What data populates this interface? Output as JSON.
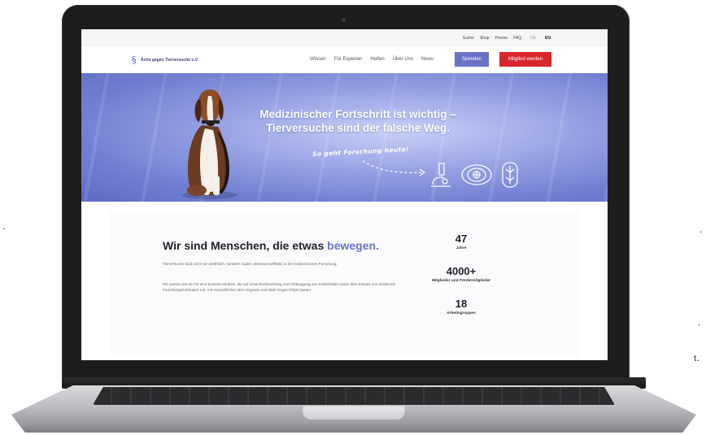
{
  "site": {
    "utility_links": [
      "Suche",
      "Shop",
      "Presse",
      "FAQ"
    ],
    "languages": [
      "DE",
      "EN"
    ],
    "active_language": "EN",
    "logo_text": "Ärzte gegen Tierversuche e.V.",
    "nav": [
      "Wissen",
      "Für Experten",
      "Helfen",
      "Über Uns",
      "News"
    ],
    "donate_label": "Spenden",
    "member_label": "Mitglied werden",
    "colors": {
      "accent": "#6a72c6",
      "cta_red": "#d8262c",
      "hero_blue": "#7381d3"
    }
  },
  "hero": {
    "title_line1": "Medizinischer Fortschritt ist wichtig –",
    "title_line2": "Tierversuche sind der falsche Weg.",
    "subtitle": "So geht Forschung heute!",
    "icons": [
      "microscope-icon",
      "organ-chip-icon",
      "cell-culture-icon"
    ]
  },
  "intro": {
    "heading_prefix": "Wir sind Menschen, die etwas",
    "heading_accent": "bewegen.",
    "paragraph1": "Tierversuche sind nicht nur unethisch, sondern zudem überaus ineffektiv in der medizinischen Forschung.",
    "paragraph2": "Wir setzen uns ein für eine bessere Medizin, die auf Ursachenforschung und Vorbeugung von Krankheiten sowie dem Einsatz von modernen Forschungsmethoden z.B. mit menschlichen Mini-Organen und Multi-Organ-Chips basiert."
  },
  "stats": [
    {
      "value": "47",
      "label": "Jahre"
    },
    {
      "value": "4000+",
      "label": "Mitglieder und Fördermitglieder"
    },
    {
      "value": "18",
      "label": "Arbeitsgruppen"
    }
  ],
  "edge_text": {
    "left": ".",
    "right1": ".",
    "right2": "t."
  }
}
